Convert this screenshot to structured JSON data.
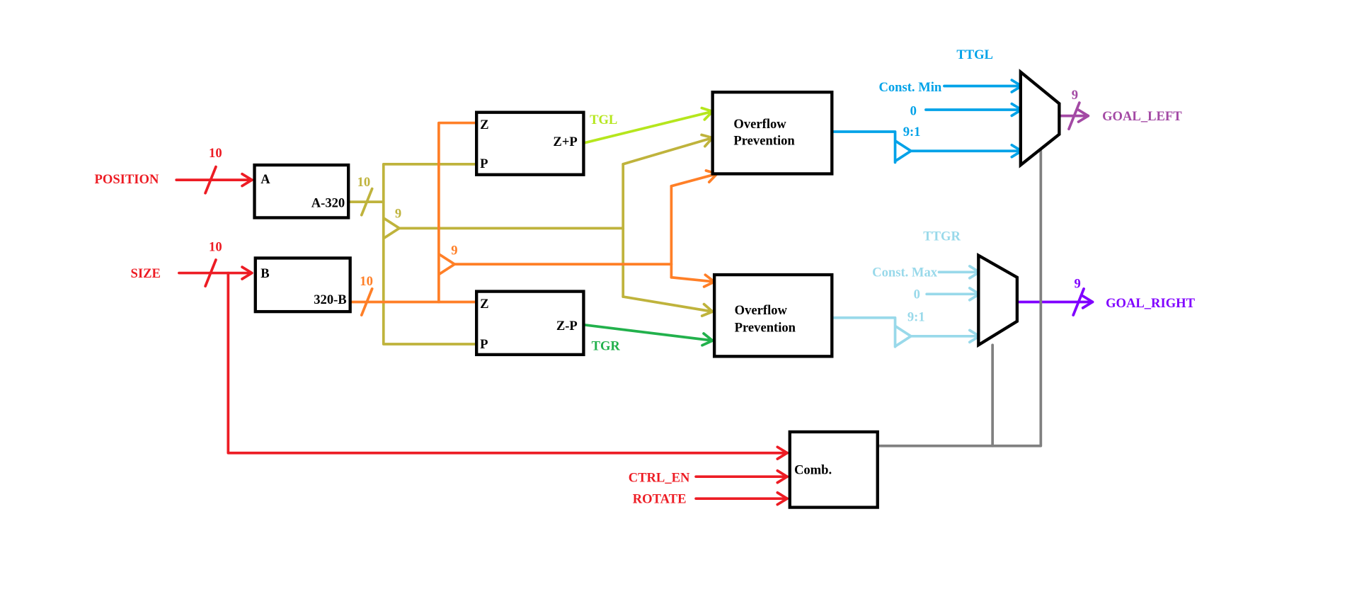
{
  "colors": {
    "input": "#ed1c24",
    "olive": "#bfb33c",
    "orange": "#ff7f27",
    "tgl": "#b5e61d",
    "tgr": "#22b14c",
    "ttgl": "#00a2e8",
    "ttgr": "#99d9ea",
    "goal_left": "#a349a4",
    "goal_right": "#8000ff",
    "control": "#808080",
    "block": "#000000"
  },
  "inputs": {
    "position": "POSITION",
    "position_width": "10",
    "size": "SIZE",
    "size_width": "10",
    "ctrl_en": "CTRL_EN",
    "rotate": "ROTATE"
  },
  "blocks": {
    "a_block": {
      "in": "A",
      "out": "A-320",
      "out_width": "10"
    },
    "b_block": {
      "in": "B",
      "out": "320-B",
      "out_width": "10"
    },
    "add_block": {
      "in_z": "Z",
      "in_p": "P",
      "out": "Z+P",
      "out_label": "TGL"
    },
    "sub_block": {
      "in_z": "Z",
      "in_p": "P",
      "out": "Z-P",
      "out_label": "TGR"
    },
    "overflow_top": {
      "line1": "Overflow",
      "line2": "Prevention"
    },
    "overflow_bottom": {
      "line1": "Overflow",
      "line2": "Prevention"
    },
    "comb": {
      "label": "Comb."
    }
  },
  "splits": {
    "olive_width": "9",
    "orange_width": "9",
    "ttgl_range": "9:1",
    "ttgr_range": "9:1"
  },
  "mux_left": {
    "select_label": "TTGL",
    "in0": "Const. Min",
    "in1": "0",
    "out_width": "9",
    "output": "GOAL_LEFT"
  },
  "mux_right": {
    "select_label": "TTGR",
    "in0": "Const. Max",
    "in1": "0",
    "out_width": "9",
    "output": "GOAL_RIGHT"
  }
}
